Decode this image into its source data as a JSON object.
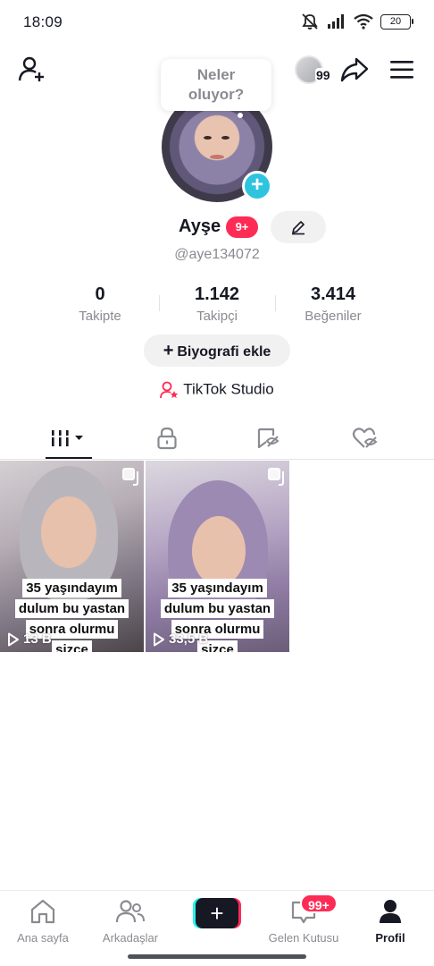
{
  "status_bar": {
    "time": "18:09",
    "battery": "20"
  },
  "header": {
    "story_prompt_line1": "Neler",
    "story_prompt_line2": "oluyor?",
    "viewer_count": "99"
  },
  "profile": {
    "name": "Ayşe",
    "name_badge": "9+",
    "handle": "@aye134072",
    "stats": [
      {
        "value": "0",
        "label": "Takipte"
      },
      {
        "value": "1.142",
        "label": "Takipçi"
      },
      {
        "value": "3.414",
        "label": "Beğeniler"
      }
    ],
    "bio_button": "Biyografi ekle",
    "studio_link": "TikTok Studio"
  },
  "videos": [
    {
      "caption_lines": [
        "35 yaşındayım",
        "dulum bu yastan",
        "sonra olurmu",
        "sizce"
      ],
      "views": "13 B"
    },
    {
      "caption_lines": [
        "35 yaşındayım",
        "dulum bu yastan",
        "sonra olurmu",
        "sizce"
      ],
      "views": "33,5 B"
    }
  ],
  "nav": {
    "home": "Ana sayfa",
    "friends": "Arkadaşlar",
    "inbox": "Gelen Kutusu",
    "inbox_badge": "99+",
    "profile": "Profil",
    "create": "+"
  },
  "colors": {
    "accent_red": "#fe2c55",
    "accent_cyan": "#25f4ee",
    "add_story_blue": "#2ec4e0"
  }
}
